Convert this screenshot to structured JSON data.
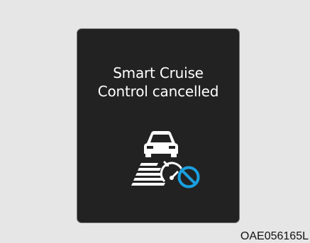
{
  "display": {
    "message_line1": "Smart Cruise",
    "message_line2": "Control cancelled",
    "icon": "smart-cruise-cancelled-icon"
  },
  "caption": "OAE056165L",
  "colors": {
    "background": "#e6e6e6",
    "panel": "#222222",
    "text": "#ffffff",
    "cancel_accent": "#1aa0e0"
  }
}
